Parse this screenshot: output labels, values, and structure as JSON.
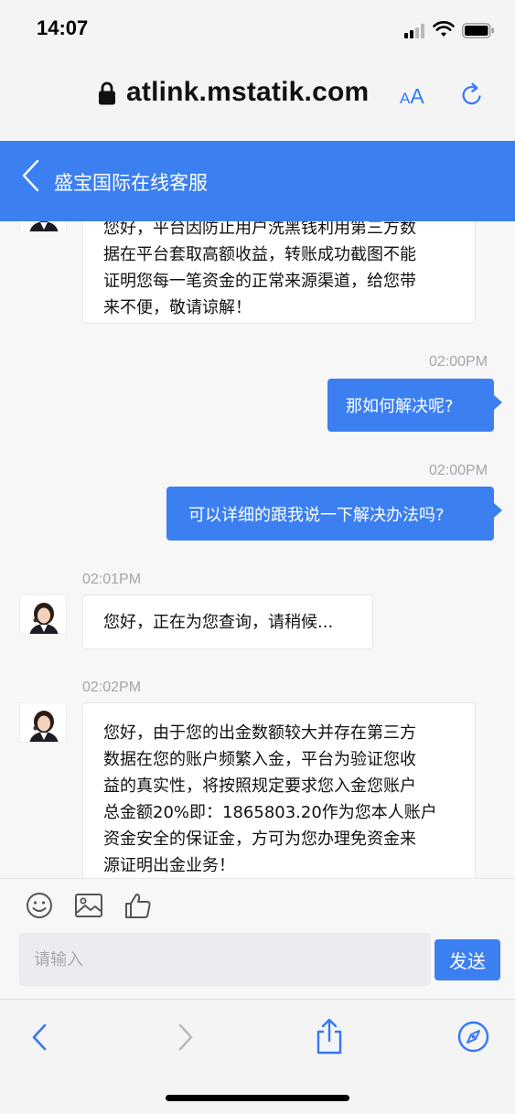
{
  "status_bar": {
    "time": "14:07"
  },
  "browser": {
    "url": "atlink.mstatik.com",
    "aa_label": "AA"
  },
  "header": {
    "title": "盛宝国际在线客服"
  },
  "messages": [
    {
      "from": "agent",
      "lines": [
        "您好，平台因防止用户洗黑钱利用第三方数",
        "据在平台套取高额收益，转账成功截图不能",
        "证明您每一笔资金的正常来源渠道，给您带",
        "来不便，敬请谅解！"
      ]
    },
    {
      "from": "user",
      "time": "02:00PM",
      "text": "那如何解决呢?"
    },
    {
      "from": "user",
      "time": "02:00PM",
      "text": "可以详细的跟我说一下解决办法吗?"
    },
    {
      "from": "agent",
      "time": "02:01PM",
      "text": "您好，正在为您查询，请稍候..."
    },
    {
      "from": "agent",
      "time": "02:02PM",
      "lines": [
        "您好，由于您的出金数额较大并存在第三方",
        "数据在您的账户频繁入金，平台为验证您收",
        "益的真实性，将按照规定要求您入金您账户",
        "总金额20%即：1865803.20作为您本人账户",
        "资金安全的保证金，方可为您办理免资金来",
        "源证明出金业务！"
      ]
    }
  ],
  "input": {
    "placeholder": "请输入",
    "send_label": "发送"
  },
  "colors": {
    "accent": "#3b7ff1",
    "ios_blue": "#3478f6"
  }
}
